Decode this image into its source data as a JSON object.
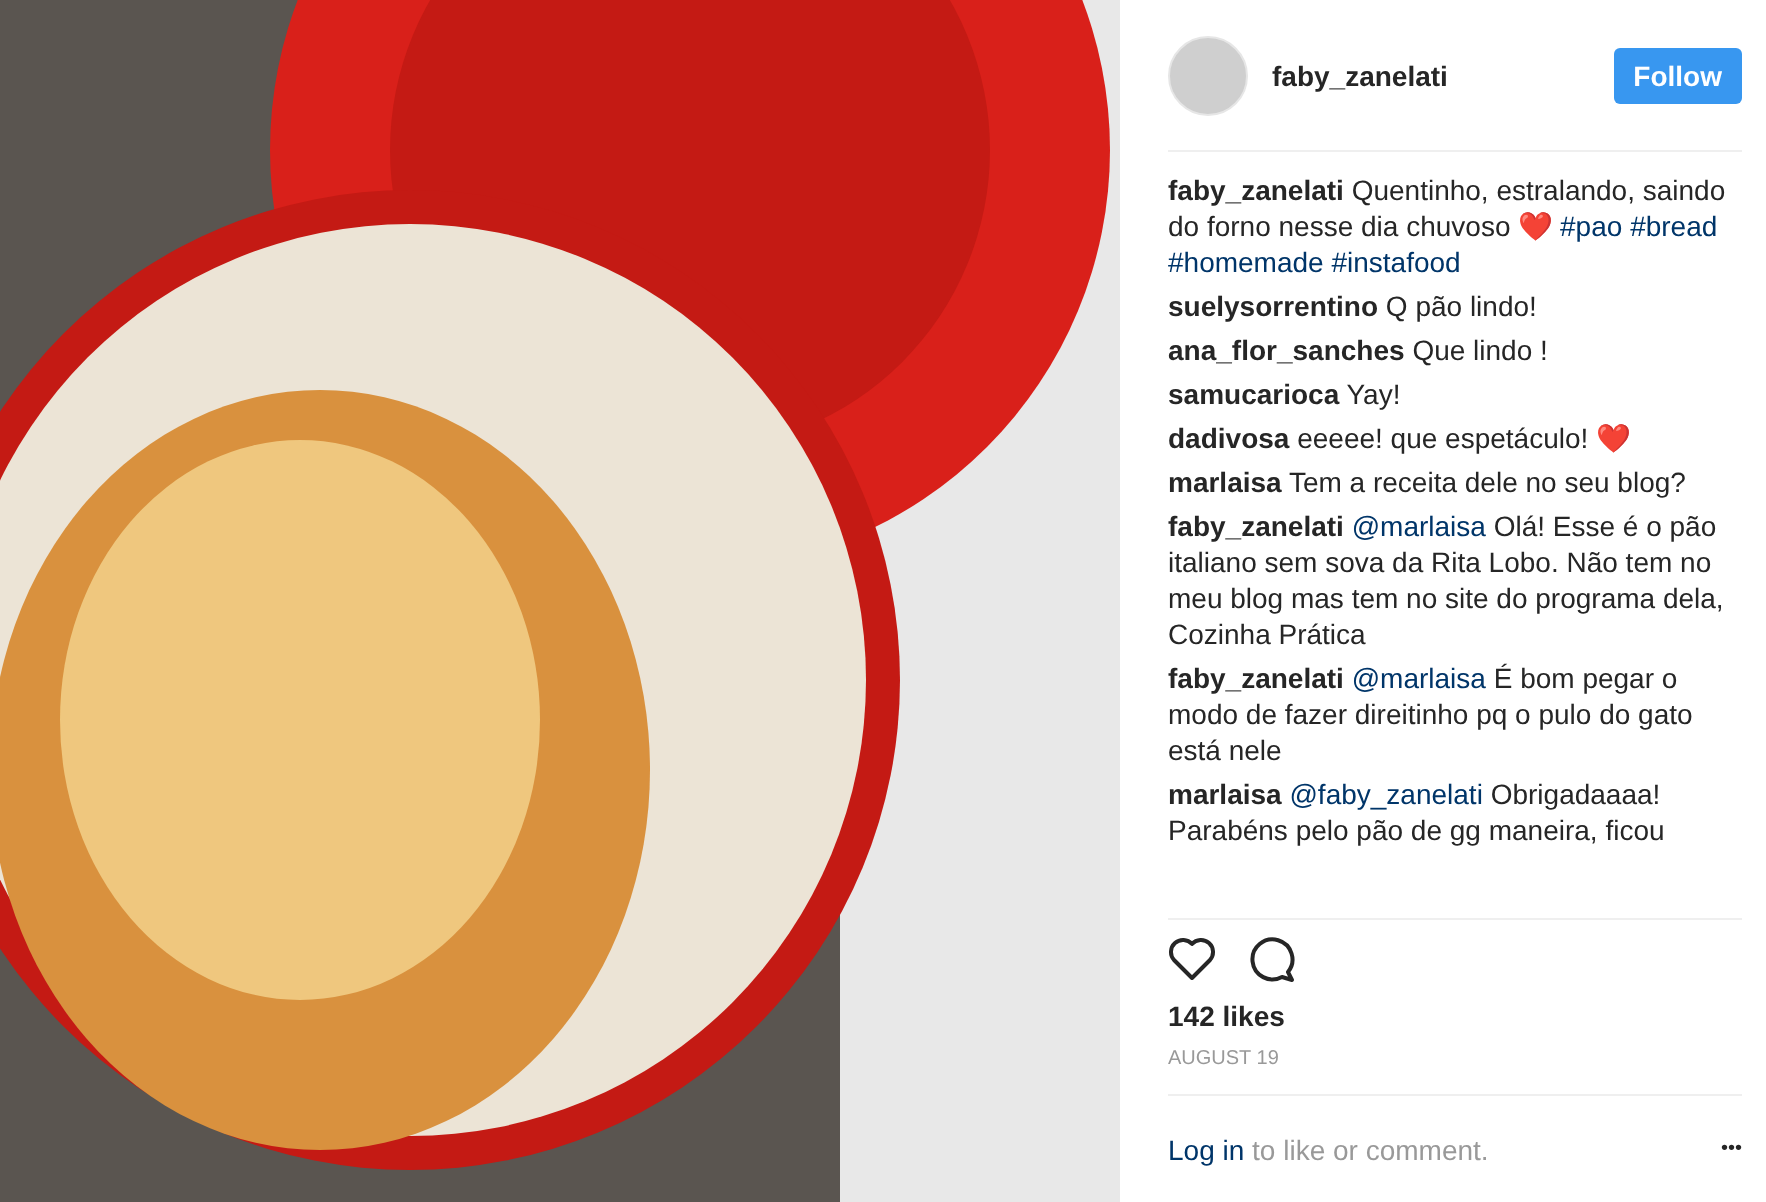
{
  "post": {
    "user": "faby_zanelati",
    "follow": "Follow"
  },
  "caption": {
    "user": "faby_zanelati",
    "text": "Quentinho, estralando, saindo do forno nesse dia chuvoso ❤️",
    "hashtags": [
      "#pao",
      "#bread",
      "#homemade",
      "#instafood"
    ]
  },
  "comments": [
    {
      "user": "suelysorrentino",
      "text": "Q pão lindo!"
    },
    {
      "user": "ana_flor_sanches",
      "text": "Que lindo !"
    },
    {
      "user": "samucarioca",
      "text": "Yay!"
    },
    {
      "user": "dadivosa",
      "text": "eeeee! que espetáculo! ❤️"
    },
    {
      "user": "marlaisa",
      "text": "Tem a receita dele no seu blog?"
    },
    {
      "user": "faby_zanelati",
      "mention": "@marlaisa",
      "text": "Olá! Esse é o pão italiano sem sova da Rita Lobo. Não tem no meu blog mas tem no site do programa dela, Cozinha Prática"
    },
    {
      "user": "faby_zanelati",
      "mention": "@marlaisa",
      "text": "É bom pegar o modo de fazer direitinho pq o pulo do gato está nele"
    },
    {
      "user": "marlaisa",
      "mention": "@faby_zanelati",
      "text": "Obrigadaaaa! Parabéns pelo pão de gg maneira, ficou"
    }
  ],
  "likes": "142 likes",
  "date": "AUGUST 19",
  "footer": {
    "link": "Log in",
    "text": "to like or comment.",
    "more": "•••"
  }
}
